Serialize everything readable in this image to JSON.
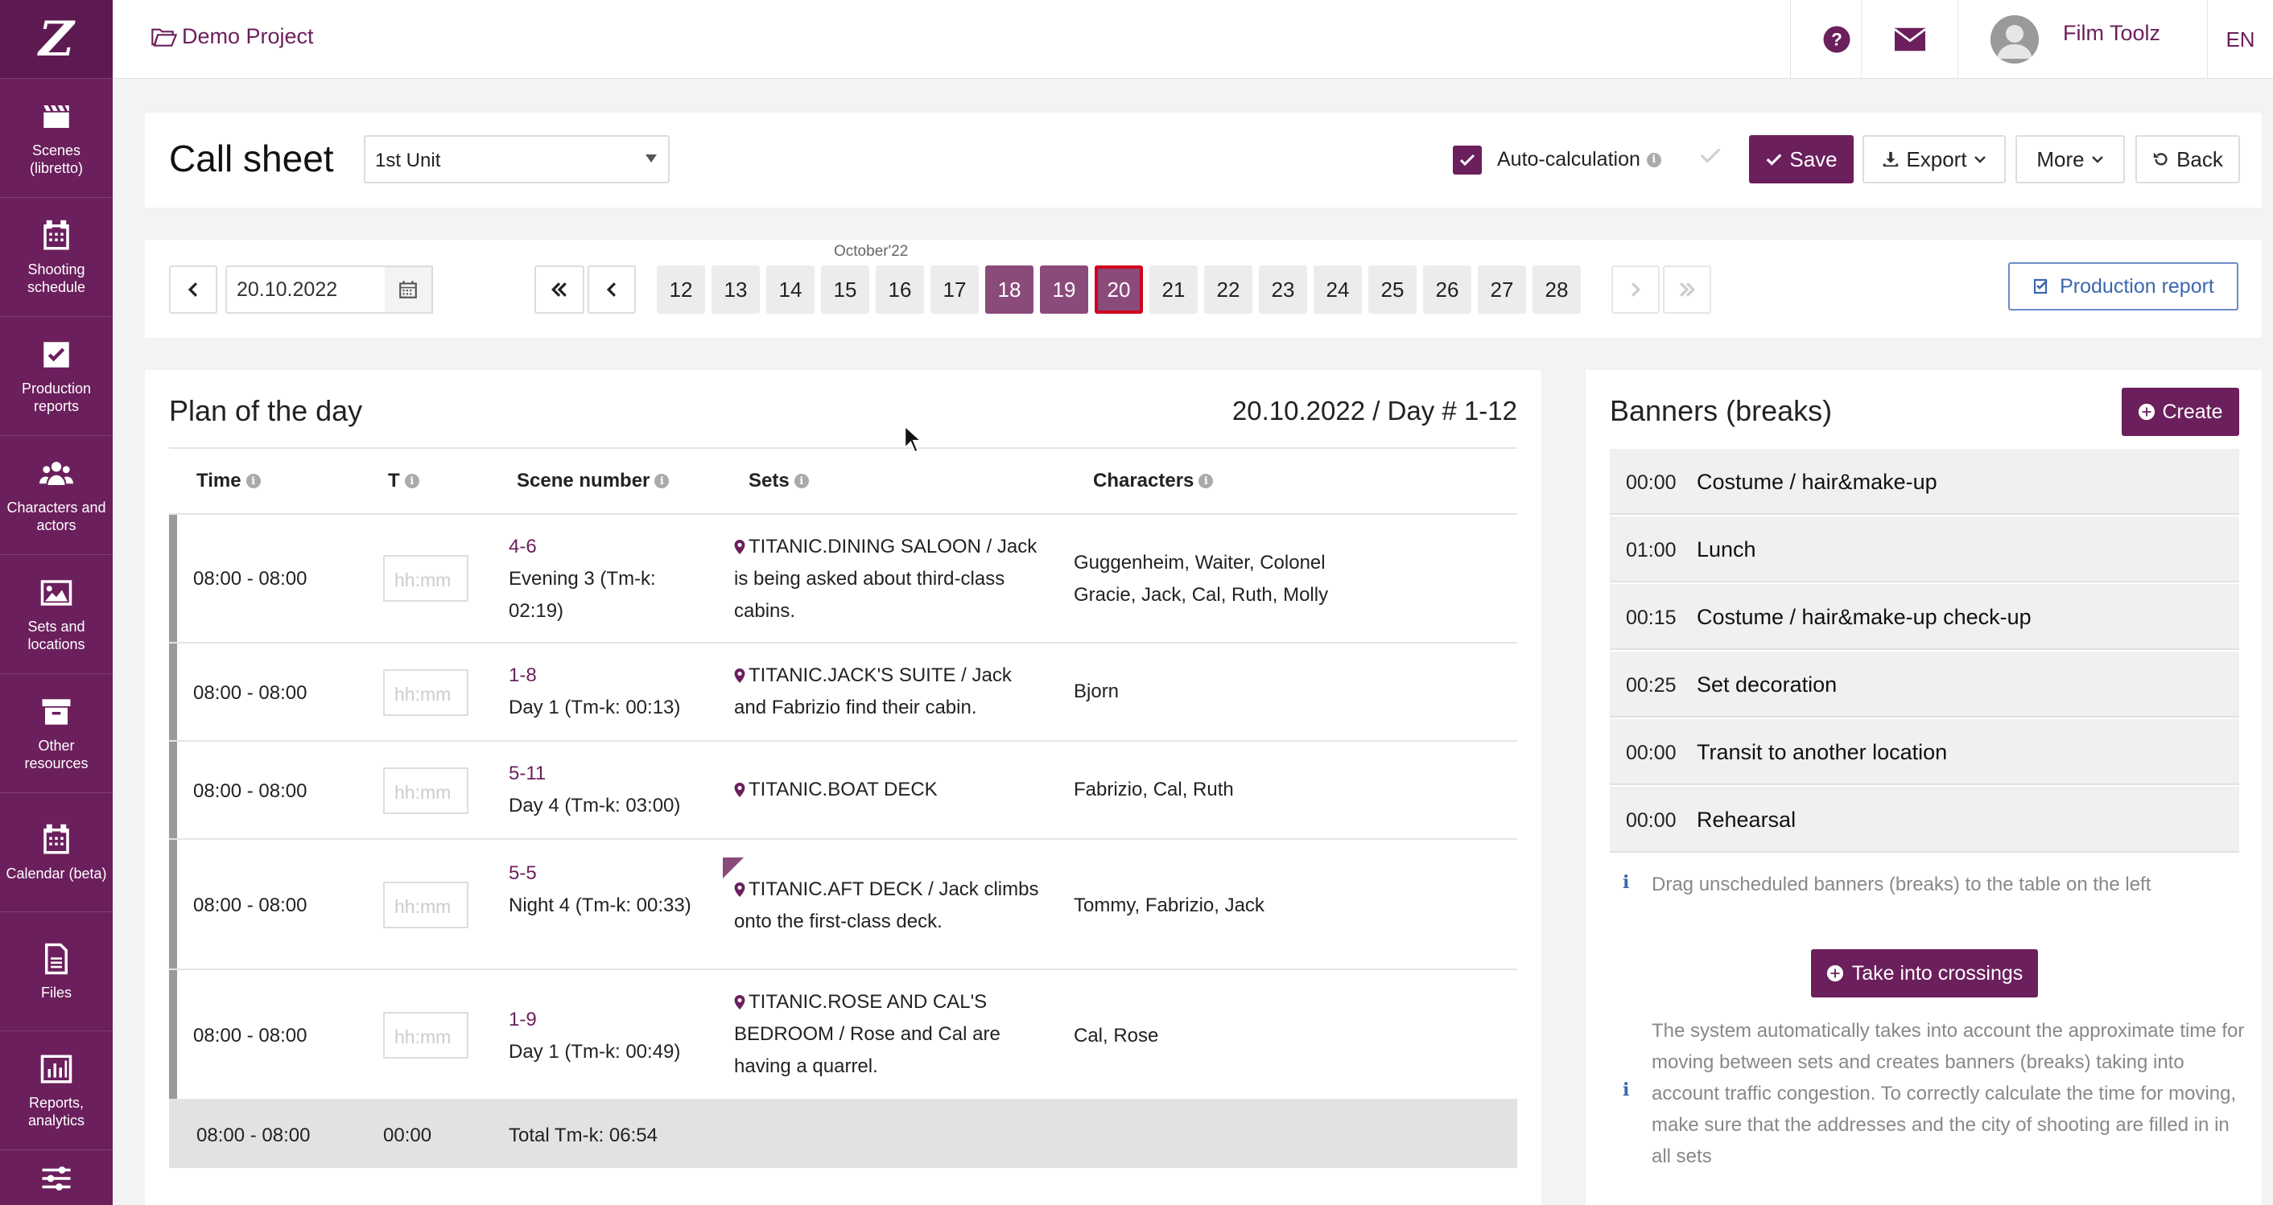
{
  "sidebar": {
    "logo": "Z",
    "items": [
      {
        "label": "Scenes (libretto)",
        "icon": "clapperboard-icon"
      },
      {
        "label": "Shooting schedule",
        "icon": "calendar-grid-icon"
      },
      {
        "label": "Production reports",
        "icon": "checkbox-icon"
      },
      {
        "label": "Characters and actors",
        "icon": "users-icon"
      },
      {
        "label": "Sets and locations",
        "icon": "image-icon"
      },
      {
        "label": "Other resources",
        "icon": "archive-box-icon"
      },
      {
        "label": "Calendar (beta)",
        "icon": "calendar-icon"
      },
      {
        "label": "Files",
        "icon": "file-icon"
      },
      {
        "label": "Reports, analytics",
        "icon": "bar-chart-icon"
      }
    ]
  },
  "header": {
    "project": "Demo Project",
    "user_name": "Film Toolz",
    "language": "EN"
  },
  "toolbar": {
    "title": "Call sheet",
    "unit": "1st Unit",
    "auto_calc_label": "Auto-calculation",
    "save_label": "Save",
    "export_label": "Export",
    "more_label": "More",
    "back_label": "Back"
  },
  "dates": {
    "current": "20.10.2022",
    "month_label": "October'22",
    "days": [
      "12",
      "13",
      "14",
      "15",
      "16",
      "17",
      "18",
      "19",
      "20",
      "21",
      "22",
      "23",
      "24",
      "25",
      "26",
      "27",
      "28"
    ],
    "highlighted": [
      "18",
      "19"
    ],
    "selected": "20",
    "production_report_label": "Production report"
  },
  "plan": {
    "title": "Plan of the day",
    "date_line": "20.10.2022 / Day # 1-12",
    "columns": {
      "time": "Time",
      "t": "T",
      "scene": "Scene number",
      "sets": "Sets",
      "chars": "Characters"
    },
    "placeholder": "hh:mm",
    "rows": [
      {
        "time": "08:00 - 08:00",
        "scene_num": "4-6",
        "scene_desc": "Evening 3 (Tm-k: 02:19)",
        "set": "TITANIC.DINING SALOON / Jack is being asked about third-class cabins.",
        "chars": "Guggenheim, Waiter, Colonel Gracie, Jaсk, Cal, Ruth, Molly"
      },
      {
        "time": "08:00 - 08:00",
        "scene_num": "1-8",
        "scene_desc": "Day 1 (Tm-k: 00:13)",
        "set": "TITANIC.JACK'S SUITE / Jack and Fabrizio find their cabin.",
        "chars": "Bjorn"
      },
      {
        "time": "08:00 - 08:00",
        "scene_num": "5-11",
        "scene_desc": "Day 4 (Tm-k: 03:00)",
        "set": "TITANIC.BOAT DECK",
        "chars": "Fabrizio, Cal, Ruth"
      },
      {
        "time": "08:00 - 08:00",
        "scene_num": "5-5",
        "scene_desc": "Night 4 (Tm-k: 00:33)",
        "set": "TITANIC.AFT DECK / Jack climbs onto the first-class deck.",
        "chars": "Tommy, Fabrizio, Jaсk"
      },
      {
        "time": "08:00 - 08:00",
        "scene_num": "1-9",
        "scene_desc": "Day 1 (Tm-k: 00:49)",
        "set": "TITANIC.ROSE AND CAL'S BEDROOM / Rose and Cal are having a quarrel.",
        "chars": "Cal, Rose"
      }
    ],
    "total": {
      "time": "08:00 - 08:00",
      "t": "00:00",
      "label": "Total Tm-k: 06:54"
    }
  },
  "banners": {
    "title": "Banners (breaks)",
    "create_label": "Create",
    "items": [
      {
        "dur": "00:00",
        "name": "Costume / hair&make-up"
      },
      {
        "dur": "01:00",
        "name": "Lunch"
      },
      {
        "dur": "00:15",
        "name": "Costume / hair&make-up check-up"
      },
      {
        "dur": "00:25",
        "name": "Set decoration"
      },
      {
        "dur": "00:00",
        "name": "Transit to another location"
      },
      {
        "dur": "00:00",
        "name": "Rehearsal"
      }
    ],
    "drag_hint": "Drag unscheduled banners (breaks) to the table on the left",
    "crossings_label": "Take into crossings",
    "system_note": "The system automatically takes into account the approximate time for moving between sets and creates banners (breaks) taking into account traffic congestion. To correctly calculate the time for moving, make sure that the addresses and the city of shooting are filled in in all sets"
  },
  "colors": {
    "brand": "#6b1f5c",
    "selected_border": "#d0021b",
    "link_blue": "#3b67b0"
  }
}
